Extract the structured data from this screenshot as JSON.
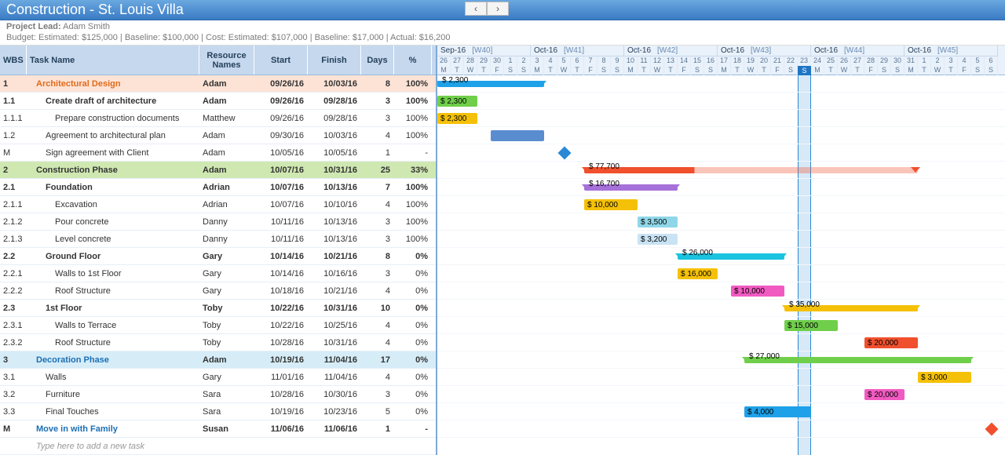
{
  "title": "Construction - St. Louis Villa",
  "project_lead_label": "Project Lead:",
  "project_lead": "Adam Smith",
  "budget_line": "Budget: Estimated: $125,000 | Baseline: $100,000 | Cost: Estimated: $107,000 | Baseline: $17,000 | Actual: $16,200",
  "columns": {
    "wbs": "WBS",
    "task": "Task Name",
    "res": "Resource Names",
    "start": "Start",
    "finish": "Finish",
    "days": "Days",
    "pct": "%"
  },
  "placeholder": "Type here to add a new task",
  "timeline": {
    "start_daynum": 26,
    "months": [
      {
        "label": "Sep-16",
        "wk": "[W40]"
      },
      {
        "label": "Oct-16",
        "wk": "[W41]"
      },
      {
        "label": "Oct-16",
        "wk": "[W42]"
      },
      {
        "label": "Oct-16",
        "wk": "[W43]"
      },
      {
        "label": "Oct-16",
        "wk": "[W44]"
      },
      {
        "label": "Oct-16",
        "wk": "[W45]"
      }
    ],
    "days": [
      26,
      27,
      28,
      29,
      30,
      1,
      2,
      3,
      4,
      5,
      6,
      7,
      8,
      9,
      10,
      11,
      12,
      13,
      14,
      15,
      16,
      17,
      18,
      19,
      20,
      21,
      22,
      23,
      24,
      25,
      26,
      27,
      28,
      29,
      30,
      31,
      1,
      2,
      3,
      4,
      5,
      6
    ],
    "dow": [
      "M",
      "T",
      "W",
      "T",
      "F",
      "S",
      "S",
      "M",
      "T",
      "W",
      "T",
      "F",
      "S",
      "S",
      "M",
      "T",
      "W",
      "T",
      "F",
      "S",
      "S",
      "M",
      "T",
      "W",
      "T",
      "F",
      "S",
      "S",
      "M",
      "T",
      "W",
      "T",
      "F",
      "S",
      "S",
      "M",
      "T",
      "W",
      "T",
      "F",
      "S",
      "S"
    ],
    "today_index": 27
  },
  "rows": [
    {
      "wbs": "1",
      "task": "Architectural Design",
      "res": "Adam",
      "start": "09/26/16",
      "finish": "10/03/16",
      "days": "8",
      "pct": "100%",
      "bold": 1,
      "hl": "peach",
      "txt": "orange",
      "ind": 1,
      "bar": {
        "type": "summary",
        "s": 0,
        "e": 7,
        "c": "#1ea1e8",
        "label": "$ 2,300"
      }
    },
    {
      "wbs": "1.1",
      "task": "Create draft of architecture",
      "res": "Adam",
      "start": "09/26/16",
      "finish": "09/28/16",
      "days": "3",
      "pct": "100%",
      "bold": 1,
      "ind": 2,
      "bar": {
        "type": "task",
        "s": 0,
        "e": 2,
        "c": "#6fcf4b",
        "label": "$ 2,300"
      }
    },
    {
      "wbs": "1.1.1",
      "task": "Prepare construction documents",
      "res": "Matthew",
      "start": "09/26/16",
      "finish": "09/28/16",
      "days": "3",
      "pct": "100%",
      "ind": 3,
      "bar": {
        "type": "task",
        "s": 0,
        "e": 2,
        "c": "#f5c108",
        "label": "$ 2,300"
      }
    },
    {
      "wbs": "1.2",
      "task": "Agreement to architectural plan",
      "res": "Adam",
      "start": "09/30/16",
      "finish": "10/03/16",
      "days": "4",
      "pct": "100%",
      "ind": 2,
      "bar": {
        "type": "task",
        "s": 4,
        "e": 7,
        "c": "#5a8dd0",
        "label": ""
      }
    },
    {
      "wbs": "M",
      "task": "Sign agreement with Client",
      "res": "Adam",
      "start": "10/05/16",
      "finish": "10/05/16",
      "days": "1",
      "pct": "-",
      "ind": 2,
      "bar": {
        "type": "milestone",
        "s": 9,
        "c": "#2a89d6"
      }
    },
    {
      "wbs": "2",
      "task": "Construction Phase",
      "res": "Adam",
      "start": "10/07/16",
      "finish": "10/31/16",
      "days": "25",
      "pct": "33%",
      "bold": 1,
      "hl": "green",
      "ind": 1,
      "bar": {
        "type": "summary",
        "s": 11,
        "e": 35,
        "c": "#f0502d",
        "prog": 0.33,
        "label": "$ 77,700"
      }
    },
    {
      "wbs": "2.1",
      "task": "Foundation",
      "res": "Adrian",
      "start": "10/07/16",
      "finish": "10/13/16",
      "days": "7",
      "pct": "100%",
      "bold": 1,
      "ind": 2,
      "bar": {
        "type": "summary",
        "s": 11,
        "e": 17,
        "c": "#a671d8",
        "label": "$ 16,700"
      }
    },
    {
      "wbs": "2.1.1",
      "task": "Excavation",
      "res": "Adrian",
      "start": "10/07/16",
      "finish": "10/10/16",
      "days": "4",
      "pct": "100%",
      "ind": 3,
      "bar": {
        "type": "task",
        "s": 11,
        "e": 14,
        "c": "#f5c108",
        "label": "$ 10,000"
      }
    },
    {
      "wbs": "2.1.2",
      "task": "Pour concrete",
      "res": "Danny",
      "start": "10/11/16",
      "finish": "10/13/16",
      "days": "3",
      "pct": "100%",
      "ind": 3,
      "bar": {
        "type": "task",
        "s": 15,
        "e": 17,
        "c": "#8fd7e8",
        "label": "$ 3,500"
      }
    },
    {
      "wbs": "2.1.3",
      "task": "Level concrete",
      "res": "Danny",
      "start": "10/11/16",
      "finish": "10/13/16",
      "days": "3",
      "pct": "100%",
      "ind": 3,
      "bar": {
        "type": "task",
        "s": 15,
        "e": 17,
        "c": "#c9e3f5",
        "label": "$ 3,200"
      }
    },
    {
      "wbs": "2.2",
      "task": "Ground Floor",
      "res": "Gary",
      "start": "10/14/16",
      "finish": "10/21/16",
      "days": "8",
      "pct": "0%",
      "bold": 1,
      "ind": 2,
      "bar": {
        "type": "summary",
        "s": 18,
        "e": 25,
        "c": "#19c4e0",
        "label": "$ 26,000"
      }
    },
    {
      "wbs": "2.2.1",
      "task": "Walls to 1st Floor",
      "res": "Gary",
      "start": "10/14/16",
      "finish": "10/16/16",
      "days": "3",
      "pct": "0%",
      "ind": 3,
      "bar": {
        "type": "task",
        "s": 18,
        "e": 20,
        "c": "#f5c108",
        "label": "$ 16,000"
      }
    },
    {
      "wbs": "2.2.2",
      "task": "Roof Structure",
      "res": "Gary",
      "start": "10/18/16",
      "finish": "10/21/16",
      "days": "4",
      "pct": "0%",
      "ind": 3,
      "bar": {
        "type": "task",
        "s": 22,
        "e": 25,
        "c": "#f15ac1",
        "label": "$ 10,000"
      }
    },
    {
      "wbs": "2.3",
      "task": "1st Floor",
      "res": "Toby",
      "start": "10/22/16",
      "finish": "10/31/16",
      "days": "10",
      "pct": "0%",
      "bold": 1,
      "ind": 2,
      "bar": {
        "type": "summary",
        "s": 26,
        "e": 35,
        "c": "#f5c108",
        "label": "$ 35,000"
      }
    },
    {
      "wbs": "2.3.1",
      "task": "Walls to Terrace",
      "res": "Toby",
      "start": "10/22/16",
      "finish": "10/25/16",
      "days": "4",
      "pct": "0%",
      "ind": 3,
      "bar": {
        "type": "task",
        "s": 26,
        "e": 29,
        "c": "#6fcf4b",
        "label": "$ 15,000"
      }
    },
    {
      "wbs": "2.3.2",
      "task": "Roof Structure",
      "res": "Toby",
      "start": "10/28/16",
      "finish": "10/31/16",
      "days": "4",
      "pct": "0%",
      "ind": 3,
      "bar": {
        "type": "task",
        "s": 32,
        "e": 35,
        "c": "#f0502d",
        "label": "$ 20,000"
      }
    },
    {
      "wbs": "3",
      "task": "Decoration Phase",
      "res": "Adam",
      "start": "10/19/16",
      "finish": "11/04/16",
      "days": "17",
      "pct": "0%",
      "bold": 1,
      "hl": "blue",
      "txt": "blue",
      "ind": 1,
      "bar": {
        "type": "summary",
        "s": 23,
        "e": 39,
        "c": "#6fcf4b",
        "label": "$ 27,000"
      }
    },
    {
      "wbs": "3.1",
      "task": "Walls",
      "res": "Gary",
      "start": "11/01/16",
      "finish": "11/04/16",
      "days": "4",
      "pct": "0%",
      "ind": 2,
      "bar": {
        "type": "task",
        "s": 36,
        "e": 39,
        "c": "#f5c108",
        "label": "$ 3,000"
      }
    },
    {
      "wbs": "3.2",
      "task": "Furniture",
      "res": "Sara",
      "start": "10/28/16",
      "finish": "10/30/16",
      "days": "3",
      "pct": "0%",
      "ind": 2,
      "bar": {
        "type": "task",
        "s": 32,
        "e": 34,
        "c": "#f15ac1",
        "label": "$ 20,000"
      }
    },
    {
      "wbs": "3.3",
      "task": "Final Touches",
      "res": "Sara",
      "start": "10/19/16",
      "finish": "10/23/16",
      "days": "5",
      "pct": "0%",
      "ind": 2,
      "bar": {
        "type": "task",
        "s": 23,
        "e": 27,
        "c": "#1ea1e8",
        "label": "$ 4,000"
      }
    },
    {
      "wbs": "M",
      "task": "Move in with Family",
      "res": "Susan",
      "start": "11/06/16",
      "finish": "11/06/16",
      "days": "1",
      "pct": "-",
      "bold": 1,
      "txt": "blue",
      "ind": 1,
      "bar": {
        "type": "milestone",
        "s": 41,
        "c": "#f0502d"
      }
    }
  ]
}
